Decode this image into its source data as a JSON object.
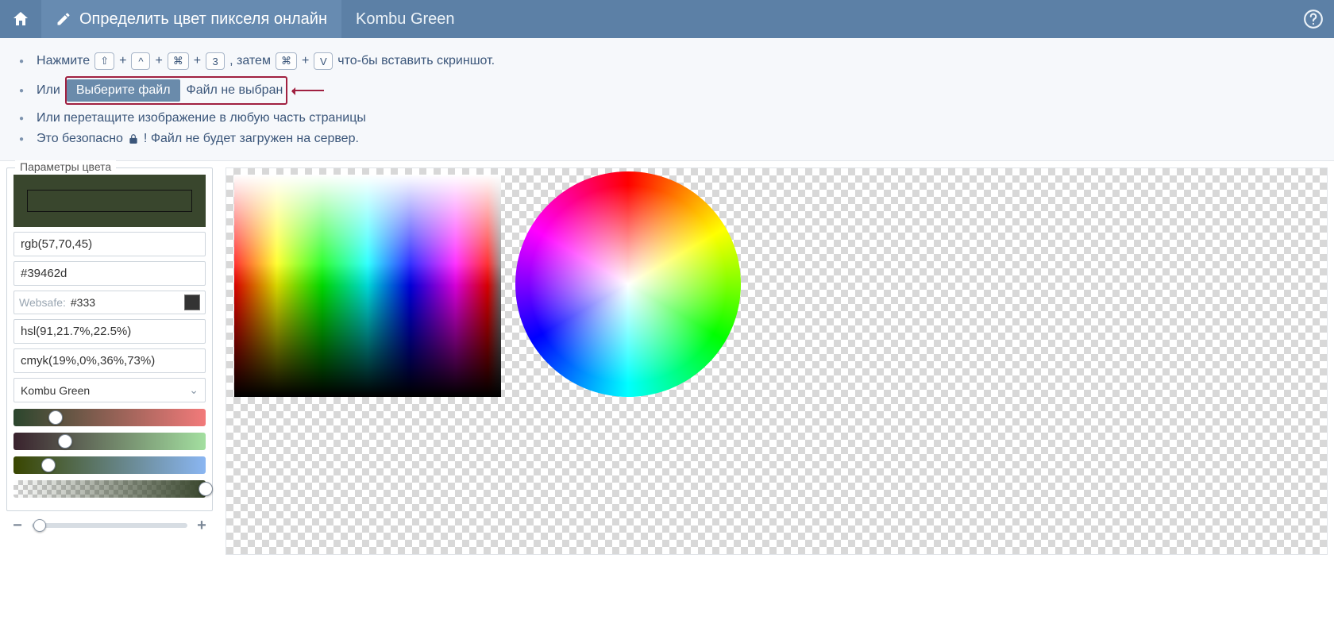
{
  "header": {
    "title": "Определить цвет пикселя онлайн",
    "subtitle": "Kombu Green"
  },
  "instructions": {
    "press": "Нажмите",
    "keys1": [
      "⇧",
      "^",
      "⌘",
      "3"
    ],
    "then": ", затем",
    "keys2": [
      "⌘",
      "V"
    ],
    "press_tail": "что-бы вставить скриншот.",
    "or": "Или",
    "choose_file": "Выберите файл",
    "no_file": "Файл не выбран",
    "drag": "Или перетащите изображение в любую часть страницы",
    "safe_pre": "Это безопасно ",
    "safe_post": "! Файл не будет загружен на сервер."
  },
  "panel": {
    "legend": "Параметры цвета",
    "swatch_hex": "#39462d",
    "rgb": "rgb(57,70,45)",
    "hex": "#39462d",
    "websafe_label": "Websafe:",
    "websafe_value": "#333",
    "websafe_chip": "#333333",
    "hsl": "hsl(91,21.7%,22.5%)",
    "cmyk": "cmyk(19%,0%,36%,73%)",
    "color_name": "Kombu Green",
    "sliders": {
      "r": 22,
      "g": 27,
      "b": 18,
      "a": 100
    }
  },
  "zoom_percent": 5
}
